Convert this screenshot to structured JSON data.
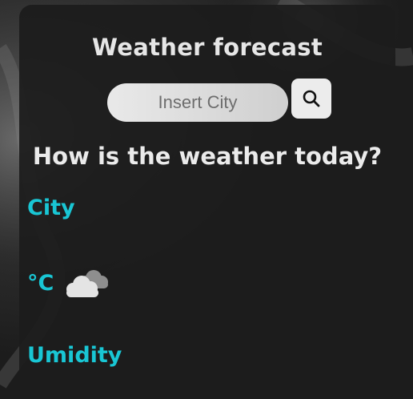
{
  "app": {
    "title": "Weather forecast"
  },
  "search": {
    "placeholder": "Insert City",
    "value": "",
    "button_icon": "search-icon"
  },
  "heading": {
    "question": "How is the weather today?"
  },
  "weather": {
    "city": "City",
    "temperature": "°C",
    "condition_icon": "cloud-icon",
    "humidity": "Umidity"
  },
  "colors": {
    "accent": "#19c6d4",
    "card": "#1c1c1c",
    "text": "#e6e6e6"
  }
}
